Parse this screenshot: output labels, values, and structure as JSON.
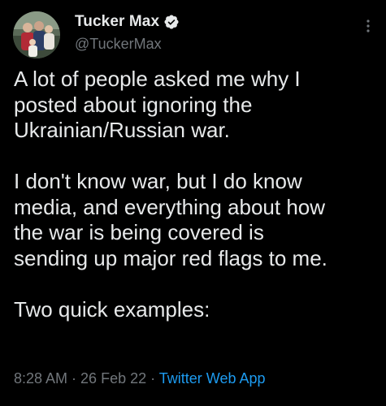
{
  "author": {
    "display_name": "Tucker Max",
    "handle": "@TuckerMax",
    "verified": true
  },
  "tweet": {
    "lines": [
      "A lot of people asked me why I",
      "posted about ignoring the",
      "Ukrainian/Russian war.",
      "",
      "I don't know war, but I do know",
      "media, and everything about how",
      "the war is being covered is",
      "sending up major red flags to me.",
      "",
      "Two quick examples:"
    ]
  },
  "meta": {
    "time": "8:28 AM",
    "separator": " · ",
    "date": "26 Feb 22",
    "source": "Twitter Web App"
  },
  "icons": {
    "verified": "verified-badge-icon",
    "more": "more-options-icon"
  },
  "colors": {
    "background": "#000000",
    "text_primary": "#e7e9ea",
    "text_secondary": "#71767b",
    "link": "#1d9bf0"
  }
}
